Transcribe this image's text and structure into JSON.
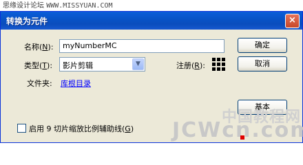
{
  "watermark_top": {
    "site": "思缘设计论坛",
    "url": "WWW.MISSYUAN.COM"
  },
  "dialog": {
    "title": "转换为元件",
    "close_glyph": "×",
    "name_label": "名称(",
    "name_key": "N",
    "name_label_end": "):",
    "name_value": "myNumberMC",
    "type_label": "类型(",
    "type_key": "T",
    "type_label_end": "):",
    "type_value": "影片剪辑",
    "type_arrow": "▼",
    "registration_label": "注册(",
    "registration_key": "R",
    "registration_label_end": "):",
    "folder_label": "文件夹:",
    "folder_value": "库根目录",
    "ok_button": "确定",
    "cancel_button": "取消",
    "basic_button": "基本",
    "scale9_label": "启用 9 切片缩放比例辅助线(",
    "scale9_key": "G",
    "scale9_label_end": ")"
  },
  "watermark_bottom": {
    "cn": "中国教程网",
    "en": "JCWcn.com"
  }
}
